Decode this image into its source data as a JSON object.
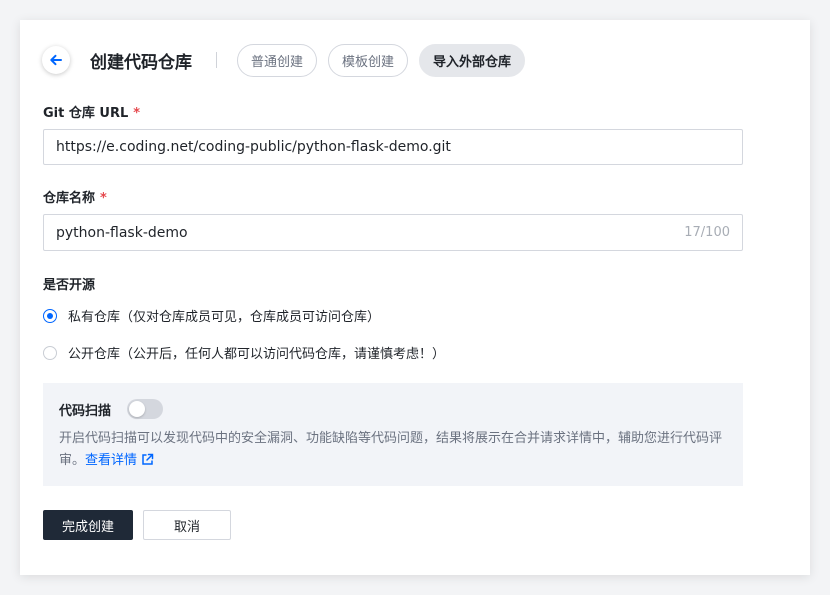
{
  "header": {
    "title": "创建代码仓库",
    "tabs": [
      {
        "label": "普通创建",
        "active": false
      },
      {
        "label": "模板创建",
        "active": false
      },
      {
        "label": "导入外部仓库",
        "active": true
      }
    ]
  },
  "form": {
    "git_url": {
      "label": "Git 仓库 URL",
      "required_mark": "*",
      "value": "https://e.coding.net/coding-public/python-flask-demo.git"
    },
    "repo_name": {
      "label": "仓库名称",
      "required_mark": "*",
      "value": "python-flask-demo",
      "counter": "17/100"
    },
    "open_source": {
      "label": "是否开源",
      "options": [
        {
          "label": "私有仓库（仅对仓库成员可见，仓库成员可访问仓库）",
          "checked": true
        },
        {
          "label": "公开仓库（公开后，任何人都可以访问代码仓库，请谨慎考虑！）",
          "checked": false
        }
      ]
    },
    "code_scan": {
      "title": "代码扫描",
      "enabled": false,
      "description": "开启代码扫描可以发现代码中的安全漏洞、功能缺陷等代码问题，结果将展示在合并请求详情中，辅助您进行代码评审。",
      "link_text": "查看详情"
    }
  },
  "actions": {
    "submit_label": "完成创建",
    "cancel_label": "取消"
  },
  "colors": {
    "primary_button": "#1f2937",
    "accent_blue": "#0066ff",
    "required_red": "#e5484d",
    "scan_background": "#f2f4f8"
  },
  "icons": {
    "back": "arrow-left-icon",
    "external": "external-link-icon"
  }
}
